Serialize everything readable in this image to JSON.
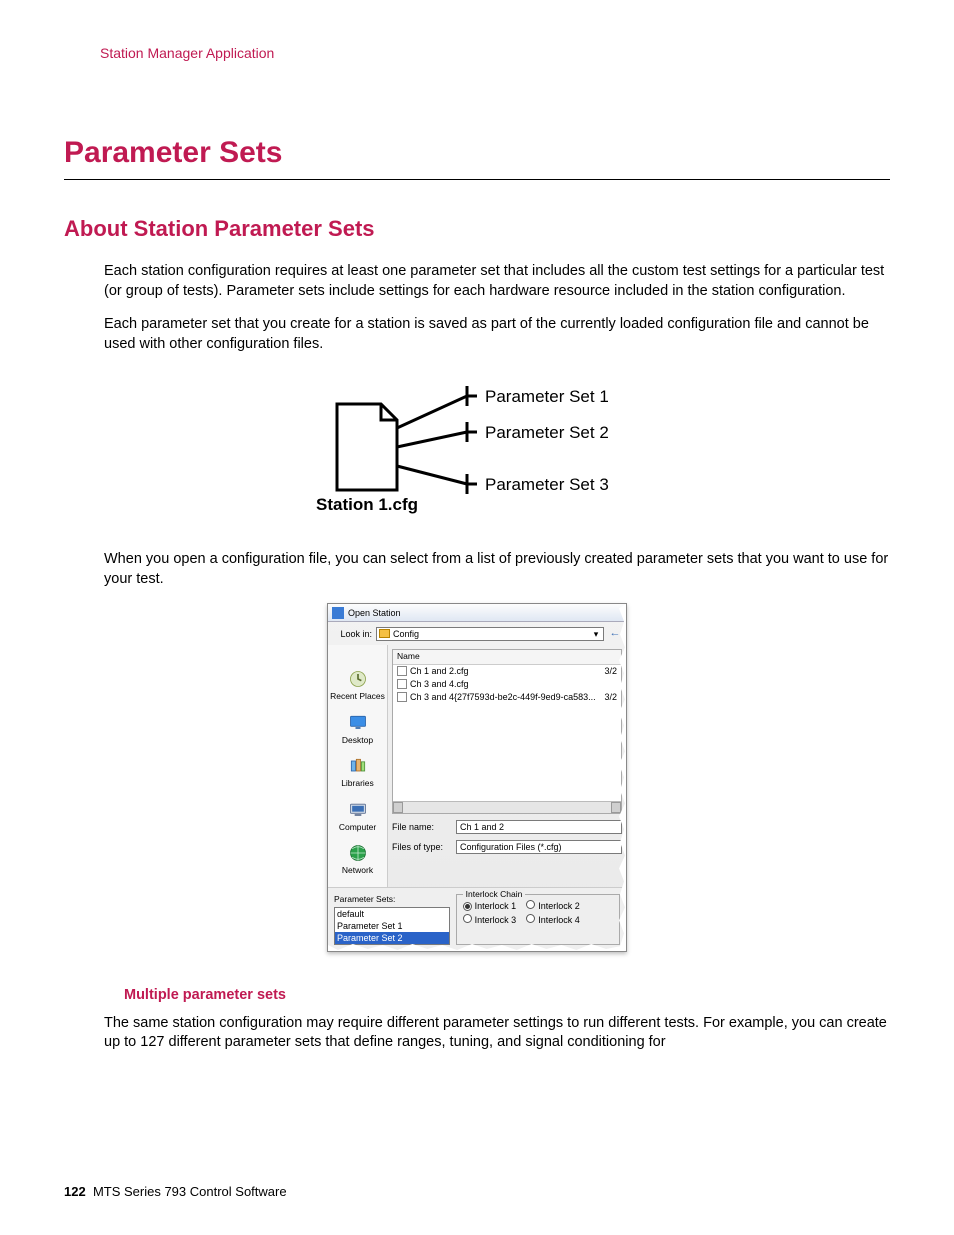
{
  "header": {
    "running_head": "Station Manager Application"
  },
  "section": {
    "title": "Parameter Sets"
  },
  "subsection": {
    "title": "About Station Parameter Sets"
  },
  "paragraphs": {
    "p1": "Each station configuration requires at least one parameter set that includes all the custom test settings for a particular test (or group of tests). Parameter sets include settings for each hardware resource included in the station configuration.",
    "p2": "Each parameter set that you create for a station is saved as part of the currently loaded configuration file and cannot be used with other configuration files.",
    "p3": "When you open a configuration file, you can select from a list of previously created parameter sets that you want to use for your test.",
    "p4": "The same station configuration may require different parameter settings to run different tests. For example, you can create up to 127 different parameter sets that define ranges, tuning, and signal conditioning for"
  },
  "diagram": {
    "file_label": "Station 1.cfg",
    "ps1": "Parameter Set 1",
    "ps2": "Parameter Set 2",
    "ps3": "Parameter Set 3"
  },
  "dialog": {
    "title": "Open Station",
    "lookin_label": "Look in:",
    "lookin_value": "Config",
    "places": {
      "recent": "Recent Places",
      "desktop": "Desktop",
      "libraries": "Libraries",
      "computer": "Computer",
      "network": "Network"
    },
    "list_header": "Name",
    "files": [
      {
        "name": "Ch 1 and 2.cfg",
        "date": "3/2"
      },
      {
        "name": "Ch 3 and 4.cfg",
        "date": ""
      },
      {
        "name": "Ch 3 and 4{27f7593d-be2c-449f-9ed9-ca583...",
        "date": "3/2"
      }
    ],
    "file_name_label": "File name:",
    "file_name_value": "Ch 1 and 2",
    "file_type_label": "Files of type:",
    "file_type_value": "Configuration Files (*.cfg)",
    "psets_label": "Parameter Sets:",
    "psets": [
      "default",
      "Parameter Set 1",
      "Parameter Set 2"
    ],
    "psets_selected_index": 2,
    "interlock": {
      "legend": "Interlock Chain",
      "options": [
        "Interlock 1",
        "Interlock 2",
        "Interlock 3",
        "Interlock 4"
      ],
      "selected_index": 0
    }
  },
  "caption": {
    "multiple": "Multiple parameter sets"
  },
  "footer": {
    "page": "122",
    "doc": "MTS Series 793 Control Software"
  }
}
